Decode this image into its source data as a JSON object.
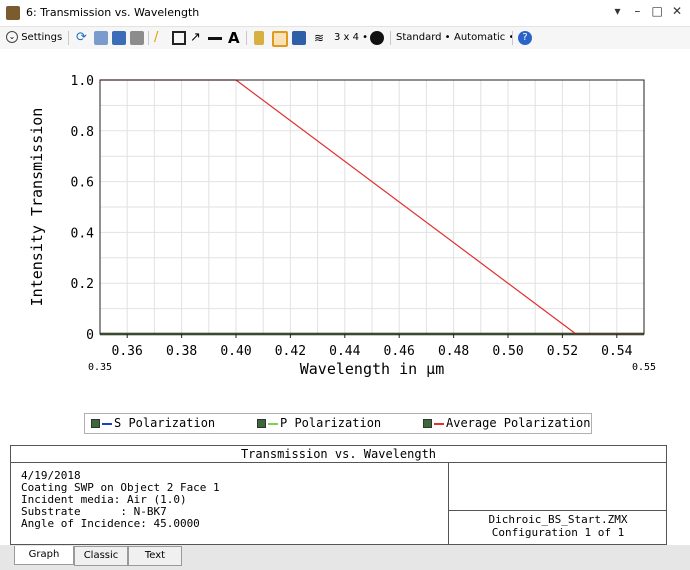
{
  "window": {
    "title": "6: Transmission vs. Wavelength",
    "controls": [
      "▾",
      "–",
      "□",
      "✕"
    ]
  },
  "toolbar": {
    "settings_label": "Settings",
    "layout_label": "3 x 4 •",
    "standard_label": "Standard •",
    "automatic_label": "Automatic •",
    "icons": [
      "refresh-icon",
      "copy-icon",
      "save-icon",
      "print-icon",
      "pencil-icon",
      "rectangle-icon",
      "arrow-icon",
      "line-icon",
      "text-icon",
      "lock-icon",
      "fit-icon",
      "window-icon",
      "layers-icon",
      "clock-icon",
      "help-icon"
    ]
  },
  "chart_data": {
    "type": "line",
    "ylabel": "Intensity Transmission",
    "xlabel": "Wavelength in µm",
    "xlim": [
      0.35,
      0.55
    ],
    "ylim": [
      0,
      1.0
    ],
    "x_ticks": [
      "0.36",
      "0.38",
      "0.40",
      "0.42",
      "0.44",
      "0.46",
      "0.48",
      "0.50",
      "0.52",
      "0.54"
    ],
    "y_ticks": [
      "0",
      "0.2",
      "0.4",
      "0.6",
      "0.8",
      "1.0"
    ],
    "x_min_label": "0.35",
    "x_max_label": "0.55",
    "series": [
      {
        "name": "S Polarization",
        "color": "#1f3fbf",
        "x": [
          0.35,
          0.55
        ],
        "y": [
          0.0,
          0.0
        ]
      },
      {
        "name": "P Polarization",
        "color": "#7fd04a",
        "x": [
          0.35,
          0.55
        ],
        "y": [
          0.0,
          0.0
        ]
      },
      {
        "name": "Average Polarization",
        "color": "#e03030",
        "x": [
          0.35,
          0.4,
          0.525,
          0.55
        ],
        "y": [
          1.0,
          1.0,
          0.0,
          0.0
        ]
      }
    ]
  },
  "legend": {
    "s_label": "S Polarization",
    "p_label": "P Polarization",
    "avg_label": "Average Polarization"
  },
  "info": {
    "title": "Transmission vs. Wavelength",
    "lines": [
      "4/19/2018",
      "Coating SWP on Object 2 Face 1",
      "Incident media: Air (1.0)",
      "Substrate      : N-BK7",
      "Angle of Incidence: 45.0000"
    ],
    "file": "Dichroic_BS_Start.ZMX",
    "config": "Configuration 1 of 1"
  },
  "tabs": {
    "graph": "Graph",
    "classic": "Classic",
    "text": "Text"
  }
}
